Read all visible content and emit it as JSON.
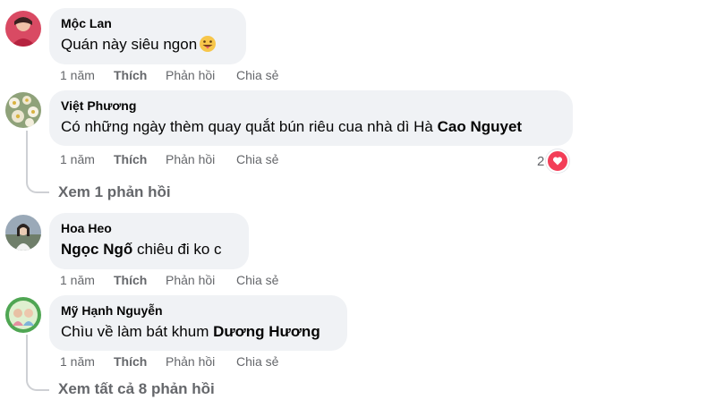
{
  "actions": {
    "time": "1 năm",
    "like": "Thích",
    "reply": "Phản hồi",
    "share": "Chia sẻ"
  },
  "comments": [
    {
      "author": "Mộc Lan",
      "text": "Quán này siêu ngon",
      "emoji": "grinning-tongue-emoji"
    },
    {
      "author": "Việt Phương",
      "text": "Có những ngày thèm quay quắt bún riêu cua nhà dì Hà",
      "mention": "Cao Nguyet",
      "reaction_count": "2",
      "reaction_icon": "heart-icon",
      "see_replies": "Xem 1 phản hồi"
    },
    {
      "author": "Hoa Heo",
      "mention": "Ngọc Ngố",
      "text": "chiêu đi ko c"
    },
    {
      "author": "Mỹ Hạnh Nguyễn",
      "text": "Chìu về làm bát khum",
      "mention": "Dương Hương",
      "see_replies": "Xem tất cả 8 phản hồi"
    }
  ],
  "colors": {
    "bubble": "#f0f2f5",
    "meta_text": "#65676b",
    "heart": "#f33e58"
  }
}
